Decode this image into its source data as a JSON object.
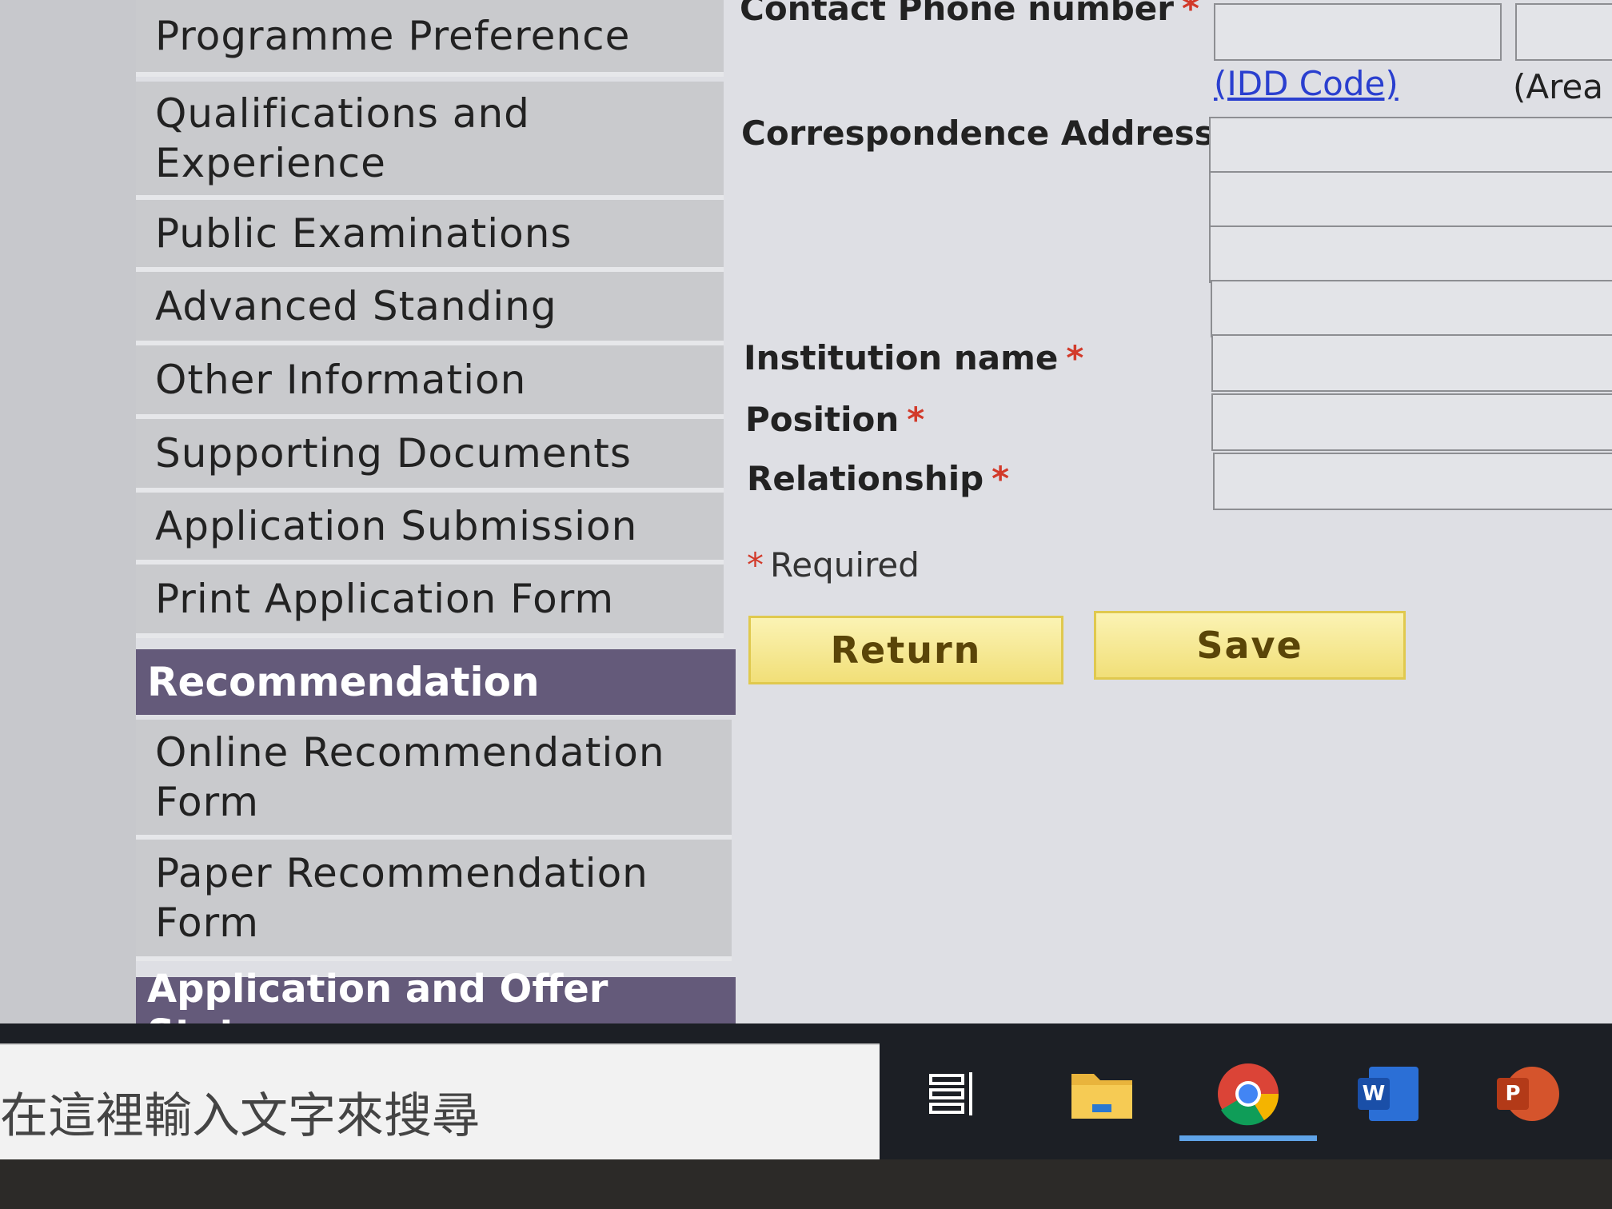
{
  "sidebar": {
    "items": [
      {
        "label": "Programme Preference"
      },
      {
        "label": "Qualifications and Experience"
      },
      {
        "label": "Public Examinations"
      },
      {
        "label": "Advanced Standing"
      },
      {
        "label": "Other Information"
      },
      {
        "label": "Supporting Documents"
      },
      {
        "label": "Application Submission"
      },
      {
        "label": "Print Application Form"
      }
    ],
    "recommendation": {
      "heading": "Recommendation",
      "items": [
        {
          "label": "Online Recommendation Form"
        },
        {
          "label": "Paper Recommendation Form"
        }
      ]
    },
    "status_heading": "Application and Offer Status"
  },
  "form": {
    "contact_phone_label": "Contact Phone number",
    "required_mark": "*",
    "idd_link": "(IDD Code)",
    "area_label": "(Area",
    "address_label": "Correspondence Address",
    "institution_label": "Institution name",
    "position_label": "Position",
    "relationship_label": "Relationship",
    "required_note": "Required",
    "return_button": "Return",
    "save_button": "Save"
  },
  "taskbar": {
    "search_placeholder": "在這裡輸入文字來搜尋",
    "icons": [
      "task-view-icon",
      "file-explorer-icon",
      "chrome-icon",
      "word-icon",
      "powerpoint-icon"
    ]
  },
  "colors": {
    "section_header": "#645a7a",
    "nav_item": "#c9cacd",
    "button": "#f1df78",
    "required": "#d23a2a",
    "link": "#2a3fcf"
  }
}
